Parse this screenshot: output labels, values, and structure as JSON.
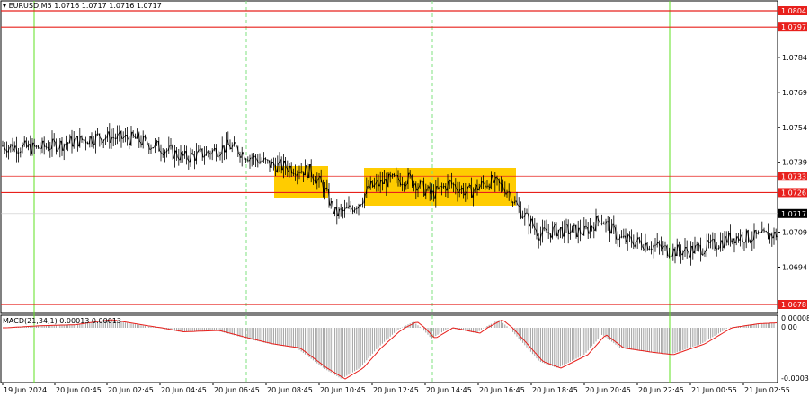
{
  "header": {
    "symbol": "EURUSD,M5",
    "ohlc": "1.0716 1.0717 1.0716 1.0717"
  },
  "indicator": {
    "label": "MACD(21,34,1) 0.00013 0.00013",
    "scale_top": "0.00008",
    "scale_zero": "0.00",
    "scale_bottom": "-0.00038"
  },
  "colors": {
    "level_line": "#e8201c",
    "vertical_green": "#5fe020",
    "vertical_dash": "#7fe27f",
    "highlight_box": "#ffcc00",
    "macd_signal": "#e8201c",
    "macd_hist": "#a0a0a0",
    "current_price_bg": "#000000"
  },
  "price_scale": [
    "1.0804",
    "1.0797",
    "1.0784",
    "1.0769",
    "1.0754",
    "1.0739",
    "1.0733",
    "1.0726",
    "1.0717",
    "1.0709",
    "1.0694",
    "1.0678"
  ],
  "levels": [
    {
      "price": 1.0804,
      "label": "1.0804"
    },
    {
      "price": 1.0797,
      "label": "1.0797"
    },
    {
      "price": 1.0733,
      "label": "1.0733",
      "thin": true
    },
    {
      "price": 1.0726,
      "label": "1.0726"
    },
    {
      "price": 1.0678,
      "label": "1.0678"
    }
  ],
  "current_price": "1.0717",
  "time_axis": [
    "19 Jun 2024",
    "20 Jun 00:45",
    "20 Jun 02:45",
    "20 Jun 04:45",
    "20 Jun 06:45",
    "20 Jun 08:45",
    "20 Jun 10:45",
    "20 Jun 12:45",
    "20 Jun 14:45",
    "20 Jun 16:45",
    "20 Jun 18:45",
    "20 Jun 20:45",
    "20 Jun 22:45",
    "21 Jun 00:55",
    "21 Jun 02:55"
  ],
  "chart_data": {
    "type": "line",
    "title": "EURUSD,M5",
    "y_unit": "price",
    "ylim": [
      1.0674,
      1.0809
    ],
    "x": [
      "19 Jun 2024",
      "20 Jun 00:45",
      "20 Jun 02:45",
      "20 Jun 04:45",
      "20 Jun 06:45",
      "20 Jun 08:45",
      "20 Jun 10:45",
      "20 Jun 12:45",
      "20 Jun 14:45",
      "20 Jun 16:45",
      "20 Jun 18:45",
      "20 Jun 20:45",
      "20 Jun 22:45",
      "21 Jun 00:55",
      "21 Jun 02:55"
    ],
    "series": [
      {
        "values": [
          1.0746,
          1.0747,
          1.0749,
          1.0743,
          1.0745,
          1.0737,
          1.0718,
          1.073,
          1.0728,
          1.0729,
          1.0709,
          1.071,
          1.0702,
          1.0702,
          1.0708
        ]
      }
    ],
    "grid": false
  }
}
